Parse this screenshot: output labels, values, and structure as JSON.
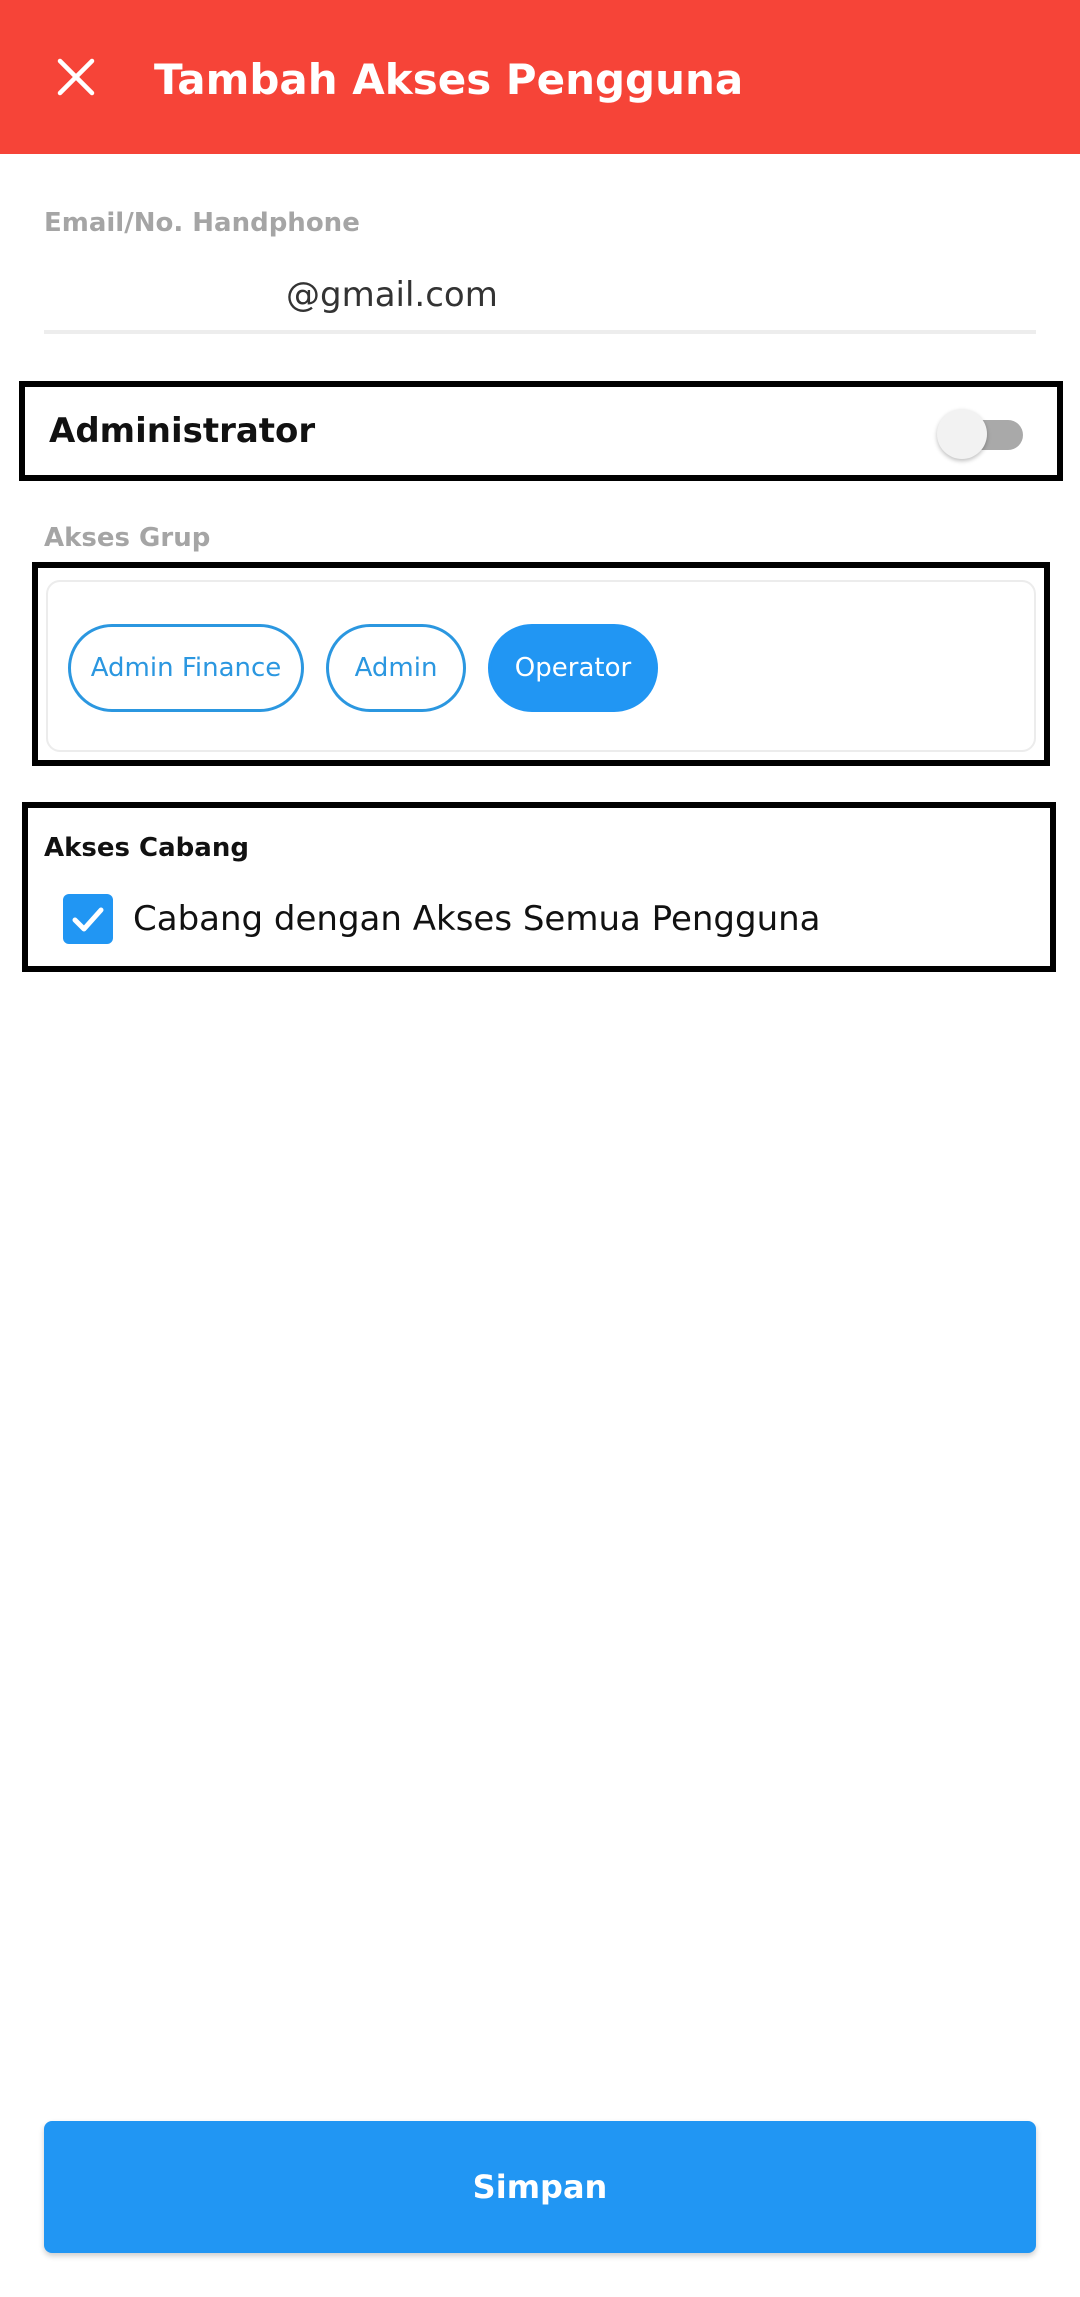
{
  "header": {
    "title": "Tambah Akses Pengguna",
    "close_icon": "close-icon",
    "background_color": "#F64438"
  },
  "email_field": {
    "label": "Email/No. Handphone",
    "value": "@gmail.com"
  },
  "administrator": {
    "label": "Administrator",
    "enabled": false
  },
  "akses_grup": {
    "label": "Akses Grup",
    "chips": [
      {
        "label": "Admin Finance",
        "selected": false
      },
      {
        "label": "Admin",
        "selected": false
      },
      {
        "label": "Operator",
        "selected": true
      }
    ]
  },
  "akses_cabang": {
    "label": "Akses Cabang",
    "checkbox_label": "Cabang dengan Akses Semua Pengguna",
    "checked": true
  },
  "footer": {
    "save_label": "Simpan",
    "accent_color": "#2196F3"
  }
}
